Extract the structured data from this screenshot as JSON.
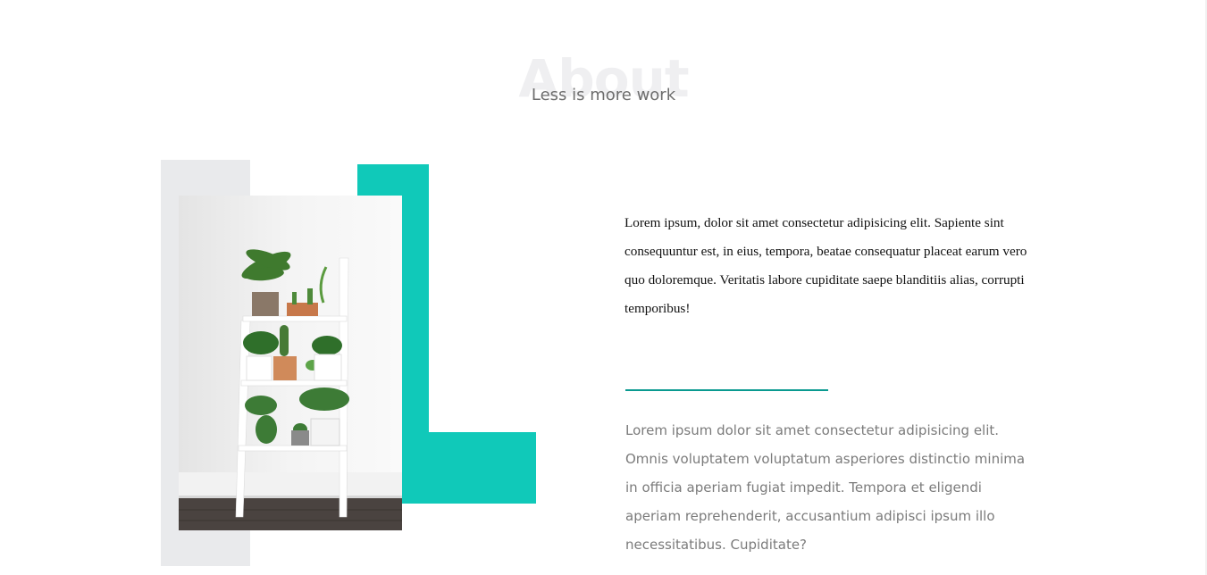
{
  "section": {
    "watermark": "About",
    "subtitle": "Less is more work"
  },
  "image": {
    "alt": "White ladder shelf with potted plants"
  },
  "content": {
    "paragraph": "Lorem ipsum, dolor sit amet consectetur adipisicing elit. Sapiente sint consequuntur est, in eius, tempora, beatae consequatur placeat earum vero quo doloremque. Veritatis labore cupiditate saepe blanditiis alias, corrupti temporibus!",
    "secondary_paragraph": "Lorem ipsum dolor sit amet consectetur adipisicing elit. Omnis voluptatem voluptatum asperiores distinctio minima in officia aperiam fugiat impedit. Tempora et eligendi aperiam reprehenderit, accusantium adipisci ipsum illo necessitatibus. Cupiditate?"
  },
  "colors": {
    "accent": "#10c9b9",
    "divider": "#0a9a90",
    "gray_block": "#e9eaec"
  }
}
